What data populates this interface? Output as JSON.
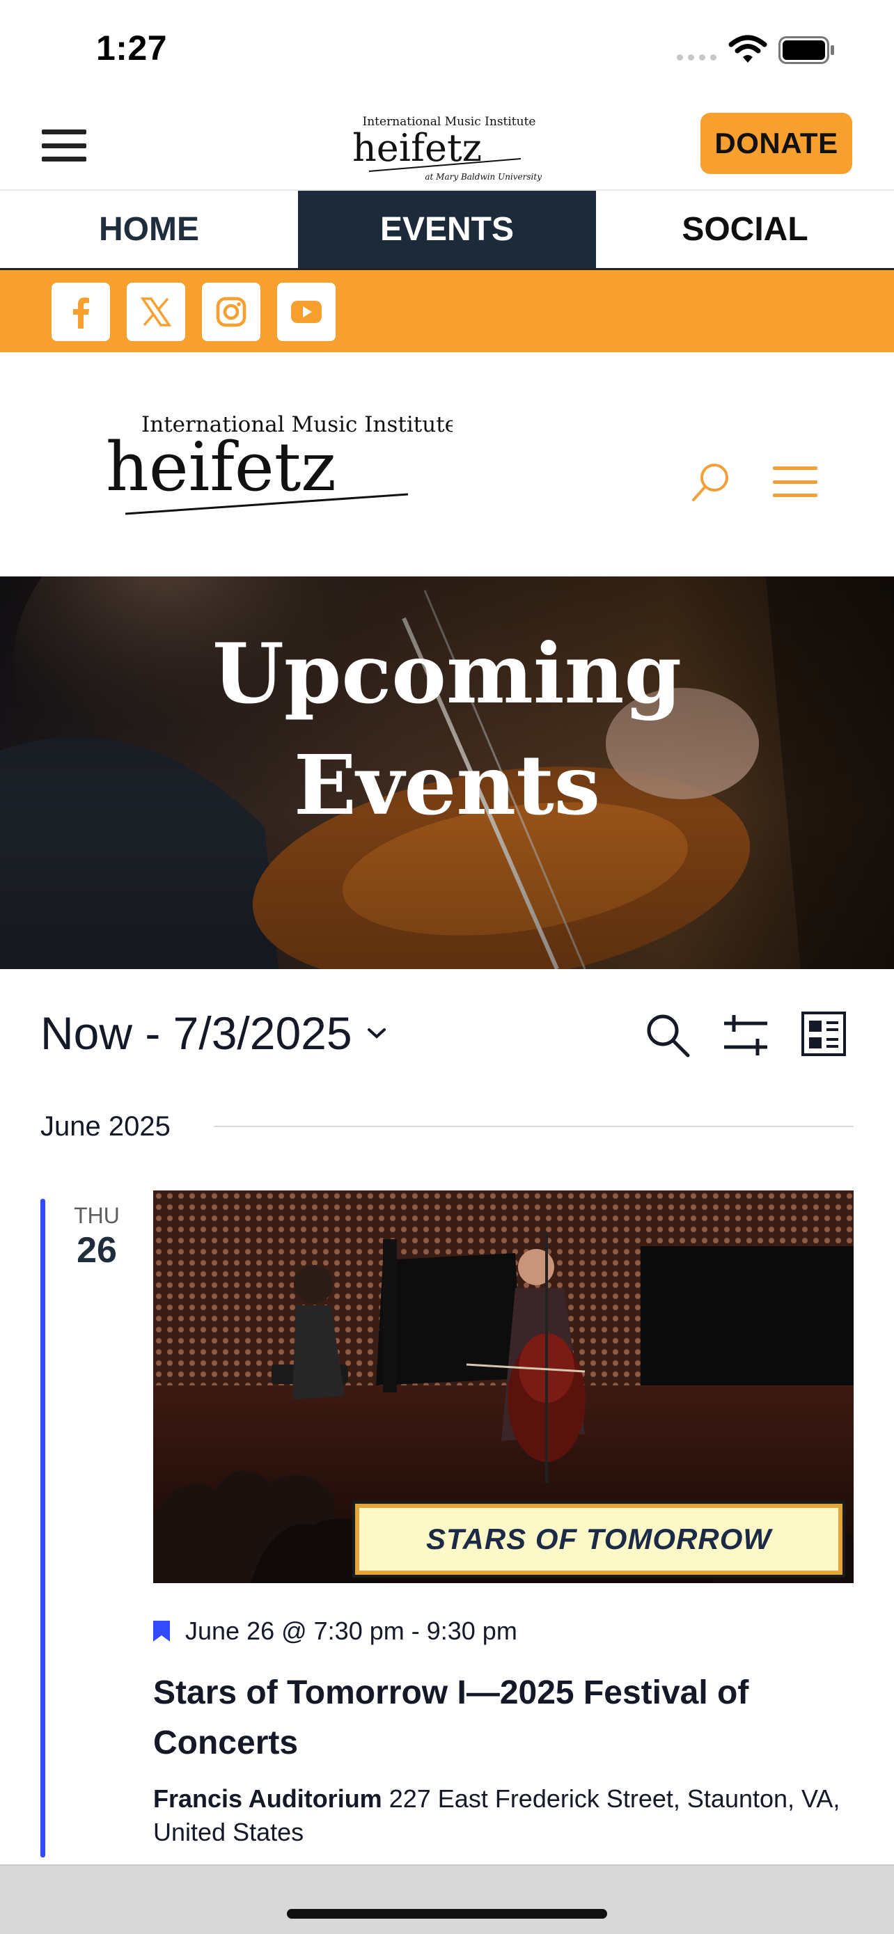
{
  "status_bar": {
    "time": "1:27"
  },
  "header": {
    "logo_top": "International Music Institute",
    "logo_main": "heifetz",
    "logo_bottom": "at Mary Baldwin University",
    "donate_label": "DONATE"
  },
  "nav": {
    "tabs": [
      {
        "label": "HOME"
      },
      {
        "label": "EVENTS",
        "active": true
      },
      {
        "label": "SOCIAL"
      }
    ]
  },
  "social": {
    "icons": [
      "facebook-icon",
      "x-icon",
      "instagram-icon",
      "youtube-icon"
    ],
    "bar_color": "#f7a030"
  },
  "hero": {
    "title_line1": "Upcoming",
    "title_line2": "Events"
  },
  "events_bar": {
    "date_range": "Now - 7/3/2025"
  },
  "month": {
    "label": "June 2025"
  },
  "event": {
    "day_of_week": "THU",
    "day": "26",
    "banner_text": "STARS OF TOMORROW",
    "time": "June 26 @ 7:30 pm - 9:30 pm",
    "title": "Stars of Tomorrow I—2025 Festival of Concerts",
    "venue_name": "Francis Auditorium",
    "venue_address": "227 East Frederick Street, Staunton, VA, United States"
  },
  "colors": {
    "accent_orange": "#f7a030",
    "nav_active": "#1c2a3a",
    "event_accent": "#334aff"
  }
}
